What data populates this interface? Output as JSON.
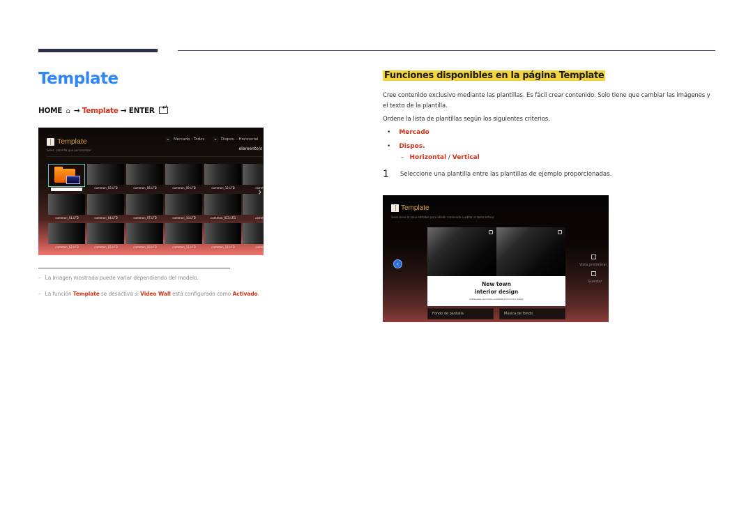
{
  "page": {
    "title": "Template",
    "nav_path": {
      "home": "HOME",
      "home_icon": "home-icon",
      "arrow": "→",
      "template": "Template",
      "enter": "ENTER",
      "enter_icon": "enter-icon"
    }
  },
  "left_screenshot": {
    "title": "Template",
    "subtitle": "Selec. plantilla que personalizar",
    "filters": [
      {
        "label": "Mercado : Todos",
        "icon": "chevron-down-icon"
      },
      {
        "label": "Dispos. : Horizontal",
        "icon": "chevron-down-icon"
      }
    ],
    "count_label": "elemento/s",
    "next_icon": "chevron-right-icon",
    "rows": [
      [
        "",
        "common_03.LFD",
        "common_06.LFD",
        "common_09.LFD",
        "common_12.LFD",
        "common"
      ],
      [
        "common_01.LFD",
        "common_04.LFD",
        "common_07.LFD",
        "common_10.LFD",
        "common_013.LFD",
        "common"
      ],
      [
        "common_02.LFD",
        "common_05.LFD",
        "common_08.LFD",
        "common_11.LFD",
        "common_14.LFD",
        "common"
      ]
    ]
  },
  "footnotes": [
    {
      "dash": "–",
      "text": "La imagen mostrada puede variar dependiendo del modelo."
    },
    {
      "dash": "–",
      "parts": [
        "La función ",
        "Template",
        " se desactiva si ",
        "Video Wall",
        " está configurado como ",
        "Activado",
        "."
      ]
    }
  ],
  "section": {
    "heading": "Funciones disponibles en la página Template",
    "para1": "Cree contenido exclusivo mediante las plantillas. Es fácil crear contenido. Solo tiene que cambiar las imágenes y el texto de la plantilla.",
    "para2": "Ordene la lista de plantillas según los siguientes criterios.",
    "bullets": [
      "Mercado",
      "Dispos."
    ],
    "bullet_char": "•",
    "sub_bullet": {
      "dash": "–",
      "a": "Horizontal",
      "sep": " / ",
      "b": "Vertical"
    },
    "step": {
      "number": "1",
      "text": "Seleccione una plantilla entre las plantillas de ejemplo proporcionadas."
    }
  },
  "right_screenshot": {
    "title": "Template",
    "subtitle": "Seleccione la zona editable para añadir contenido o editar el texto actual.",
    "card": {
      "line1": "New town",
      "line2": "interior design",
      "line3": "Sustainable resolution undefeats tomorrow's design"
    },
    "buttons": [
      "Fondo de pantalla",
      "Música de fondo"
    ],
    "side_actions": [
      {
        "label": "Vista preliminar",
        "icon": "preview-icon"
      },
      {
        "label": "Guardar",
        "icon": "save-icon"
      }
    ],
    "back_icon": "back-arrow-icon"
  },
  "colors": {
    "title_blue": "#2f86f4",
    "accent_red": "#d0341b",
    "heading_highlight": "#f2d43c",
    "screenshot_gold": "#d4a442",
    "selection_cyan": "#57c6cc"
  }
}
